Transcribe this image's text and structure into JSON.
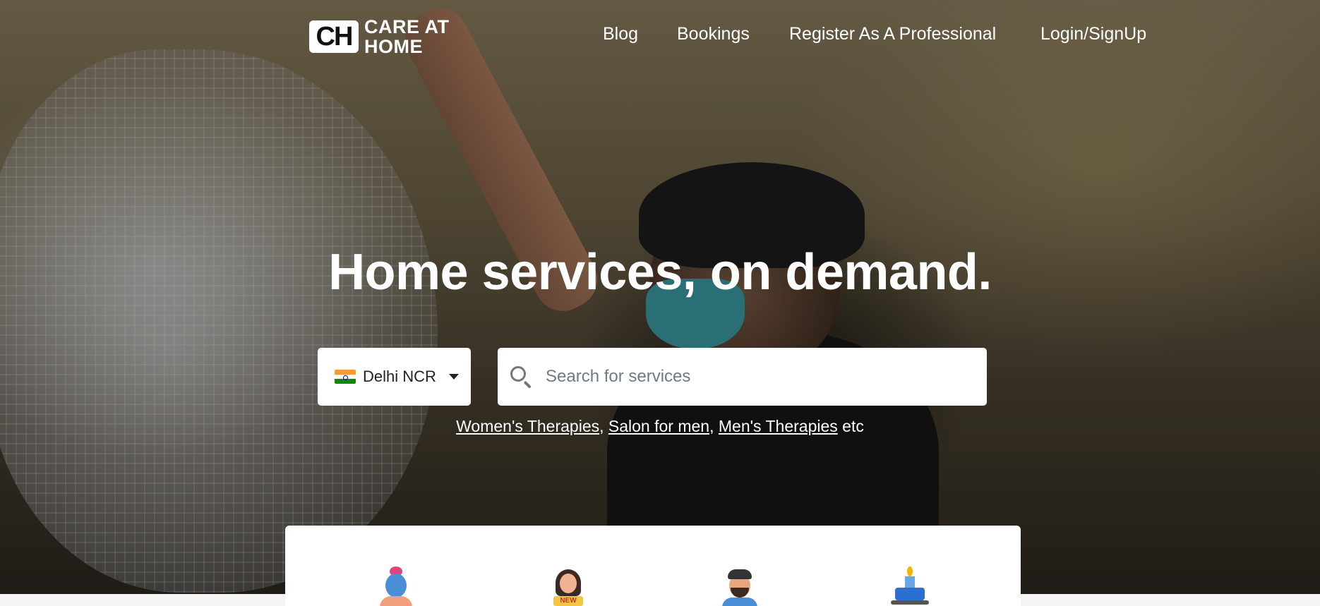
{
  "brand": {
    "logo_mark": "CH",
    "logo_line1": "CARE AT",
    "logo_line2": "HOME"
  },
  "nav": {
    "items": [
      {
        "label": "Blog"
      },
      {
        "label": "Bookings"
      },
      {
        "label": "Register As A Professional"
      },
      {
        "label": "Login/SignUp"
      }
    ]
  },
  "hero": {
    "headline": "Home services, on demand."
  },
  "city_selector": {
    "flag_icon": "india-flag-icon",
    "value": "Delhi NCR"
  },
  "search": {
    "placeholder": "Search for services",
    "value": ""
  },
  "suggestions": {
    "links": [
      "Women's Therapies",
      "Salon for men",
      "Men's Therapies"
    ],
    "separator_1": ",",
    "separator_2": ",",
    "suffix": "etc"
  },
  "categories": {
    "icons": [
      "womens-therapy-icon",
      "new-salon-women-icon",
      "salon-men-icon",
      "spa-candle-icon"
    ],
    "new_badge": "NEW"
  },
  "colors": {
    "text_on_hero": "#ffffff",
    "card_bg": "#ffffff",
    "placeholder": "#6f7a86"
  }
}
